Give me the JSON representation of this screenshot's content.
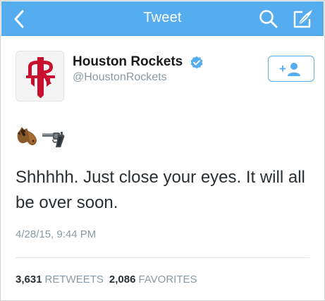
{
  "navbar": {
    "title": "Tweet",
    "color": "#55acee",
    "back_icon": "chevron-left-icon",
    "search_icon": "search-icon",
    "compose_icon": "compose-icon"
  },
  "tweet": {
    "display_name": "Houston Rockets",
    "handle": "@HoustonRockets",
    "verified": true,
    "follow_icon": "add-user-icon",
    "follow_symbol": "+",
    "emojis": [
      "horse-face-emoji",
      "pistol-emoji"
    ],
    "text": "Shhhhh. Just close your eyes. It will all be over soon.",
    "timestamp": "4/28/15, 9:44 PM"
  },
  "stats": {
    "retweets_count": "3,631",
    "retweets_label": "RETWEETS",
    "favorites_count": "2,086",
    "favorites_label": "FAVORITES"
  }
}
